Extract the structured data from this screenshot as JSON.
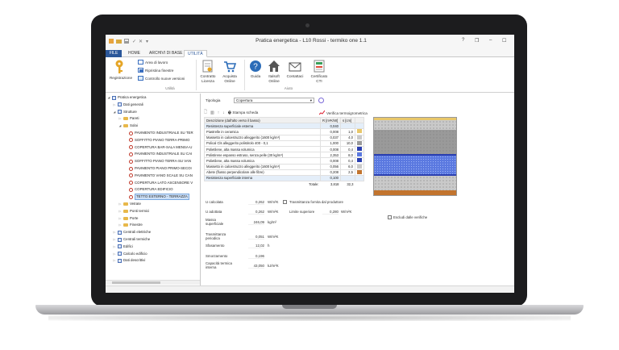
{
  "window": {
    "title": "Pratica energetica - L10 Rossi - termiko one 1.1",
    "help": "?",
    "controls": [
      "❐",
      "–",
      "☐"
    ]
  },
  "tabs": [
    {
      "label": "FILE"
    },
    {
      "label": "HOME"
    },
    {
      "label": "ARCHIVI DI BASE"
    },
    {
      "label": "UTILITÀ"
    }
  ],
  "ribbon": {
    "registrazione": "Registrazione",
    "area_lavoro": "Area di lavoro",
    "ripristina": "Ripristina finestre",
    "controllo": "Controllo nuove versioni",
    "contratto": [
      "Contratto",
      "Licenza"
    ],
    "acquista": [
      "Acquista",
      "Online"
    ],
    "guida": "Guida",
    "italsoft": [
      "Italsoft",
      "Online"
    ],
    "contattaci": "Contattaci",
    "certificato": [
      "Certificato",
      "CTI"
    ],
    "group_utility": "Utilità",
    "group_aiuto": "Aiuto"
  },
  "tree": {
    "items": [
      {
        "label": "Pratica energetica",
        "level": 0,
        "toggle": "◢",
        "icon": "blue"
      },
      {
        "label": "Dati generali",
        "level": 1,
        "toggle": "▷",
        "icon": "blue"
      },
      {
        "label": "Strutture",
        "level": 1,
        "toggle": "◢",
        "icon": "blue"
      },
      {
        "label": "Pareti",
        "level": 2,
        "toggle": "▷",
        "icon": "fold"
      },
      {
        "label": "Solai",
        "level": 2,
        "toggle": "◢",
        "icon": "fold"
      },
      {
        "label": "PAVIMENTO INDUSTRIALE SU TER",
        "level": 3,
        "toggle": "",
        "icon": "rc"
      },
      {
        "label": "SOFFITTO PIANO TERRA-PRIMO",
        "level": 3,
        "toggle": "",
        "icon": "rc"
      },
      {
        "label": "COPERTURA BAR-SALA MENSA-U",
        "level": 3,
        "toggle": "",
        "icon": "rc"
      },
      {
        "label": "PAVIMENTO INDUSTRIALE SU CAI",
        "level": 3,
        "toggle": "",
        "icon": "rc"
      },
      {
        "label": "SOFFITTO PIANO TERRA-SU VAN",
        "level": 3,
        "toggle": "",
        "icon": "rc"
      },
      {
        "label": "PAVIMENTO PIANO PRIMO-SECOI",
        "level": 3,
        "toggle": "",
        "icon": "rc"
      },
      {
        "label": "PAVIMENTO VANO SCALE SU CAN",
        "level": 3,
        "toggle": "",
        "icon": "rc"
      },
      {
        "label": "COPERTURA LATO ASCENSORE V",
        "level": 3,
        "toggle": "",
        "icon": "rc"
      },
      {
        "label": "COPERTURA EDIFICIO",
        "level": 3,
        "toggle": "",
        "icon": "rc"
      },
      {
        "label": "TETTO ESTERNO - TERRAZZA",
        "level": 3,
        "toggle": "",
        "icon": "rc",
        "selected": true
      },
      {
        "label": "Vetrate",
        "level": 2,
        "toggle": "▷",
        "icon": "fold"
      },
      {
        "label": "Ponti termici",
        "level": 2,
        "toggle": "▷",
        "icon": "fold"
      },
      {
        "label": "Porte",
        "level": 2,
        "toggle": "▷",
        "icon": "fold"
      },
      {
        "label": "Finestre",
        "level": 2,
        "toggle": "▷",
        "icon": "fold"
      },
      {
        "label": "Centrali elettriche",
        "level": 1,
        "toggle": "▷",
        "icon": "blue"
      },
      {
        "label": "Centrali termiche",
        "level": 1,
        "toggle": "▷",
        "icon": "blue"
      },
      {
        "label": "Edifici",
        "level": 1,
        "toggle": "▷",
        "icon": "blue"
      },
      {
        "label": "Calcolo edificio",
        "level": 1,
        "toggle": "▷",
        "icon": "blue"
      },
      {
        "label": "Dati descrittivi",
        "level": 1,
        "toggle": "▷",
        "icon": "blue"
      }
    ]
  },
  "main": {
    "tipologia_label": "Tipologia",
    "tipologia_value": "Copertura",
    "stampa": "Stampa scheda",
    "verifica": "Verifica termoigrometrica",
    "table": {
      "headers": [
        "Descrizione (dall'alto verso il basso)",
        "R [m²K/W]",
        "s [cm]"
      ],
      "rows": [
        {
          "desc": "Resistenza superficiale esterna",
          "r": "0,040",
          "s": "",
          "swatch": "",
          "highlight": true
        },
        {
          "desc": "Piastrelle in ceramica",
          "r": "0,008",
          "s": "1,0",
          "swatch": "#e8c76a"
        },
        {
          "desc": "Massetto in calcestruzzo alleggerito (1600 kg/m³)",
          "r": "0,037",
          "s": "4,0",
          "swatch": "#c9c9c9"
        },
        {
          "desc": "Polical Cls alleggerito polistirolo 400 - 0,1",
          "r": "1,000",
          "s": "10,0",
          "swatch": "#9a9a9a"
        },
        {
          "desc": "Polietilene, alta massa volumica",
          "r": "0,008",
          "s": "0,4",
          "swatch": "#2a3fb0"
        },
        {
          "desc": "Polistirene espanso estruso, senza pelle (30 kg/m³)",
          "r": "2,353",
          "s": "8,0",
          "swatch": "#5b79e0"
        },
        {
          "desc": "Polietilene, alta massa volumica",
          "r": "0,008",
          "s": "0,4",
          "swatch": "#2a3fb0"
        },
        {
          "desc": "Massetto in calcestruzzo alleggerito (1600 kg/m³)",
          "r": "0,056",
          "s": "6,0",
          "swatch": "#c9c9c9"
        },
        {
          "desc": "Abete (flusso perpendicolare alle fibre)",
          "r": "0,208",
          "s": "2,5",
          "swatch": "#c2742e"
        },
        {
          "desc": "Resistenza superficiale interna",
          "r": "0,100",
          "s": "",
          "swatch": "",
          "highlight": true
        }
      ],
      "total_label": "Totale:",
      "total_r": "3,818",
      "total_s": "32,3"
    },
    "results": {
      "u_calcolata_label": "U calcolata",
      "u_calcolata_value": "0,262",
      "u_calcolata_unit": "W/m²K",
      "trasmittanza_fornita": "Trasmittanza fornita dal produttore",
      "u_adottata_label": "U adottata",
      "u_adottata_value": "0,262",
      "u_adottata_unit": "W/m²K",
      "limite_label": "Limite superiore",
      "limite_value": "0,280",
      "limite_unit": "W/m²K",
      "escludi": "Escludi dalle verifiche",
      "massa_label": [
        "Massa",
        "superficiale"
      ],
      "massa_value": "246,09",
      "massa_unit": "kg/m²",
      "trasm_periodica_label": [
        "Trasmittanza",
        "periodica"
      ],
      "trasm_periodica_value": "0,051",
      "trasm_periodica_unit": "W/m²K",
      "sfasamento_label": "Sfasamento",
      "sfasamento_value": "12,02",
      "sfasamento_unit": "h",
      "smorzamento_label": "Smorzamento",
      "smorzamento_value": "0,196",
      "capacita_label": [
        "Capacità termica",
        "interna"
      ],
      "capacita_value": "43,050",
      "capacita_unit": "kJ/m²K"
    }
  }
}
